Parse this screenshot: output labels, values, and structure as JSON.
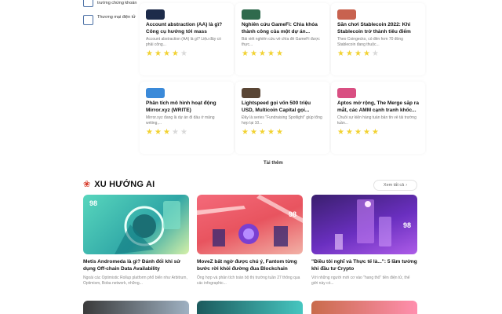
{
  "sidebar": {
    "items": [
      {
        "label": "trường chứng khoán",
        "icon": "chart-icon"
      },
      {
        "label": "Thương mại điện tử",
        "icon": "monitor-icon"
      }
    ]
  },
  "articles": [
    {
      "title": "Account abstraction (AA) là gì? Công cụ hướng tới mass adoption",
      "desc": "Account abstraction (AA) là gì? Liệu đây có phải công...",
      "rating": 4
    },
    {
      "title": "Nghiên cứu GameFi: Chìa khóa thành công của một dự án...",
      "desc": "Bài viết nghiên cứu về chìa đề GameFi được thực...",
      "rating": 5
    },
    {
      "title": "Săn chơi Stablecoin 2022: Khi Stablecoin trở thành tiêu điểm",
      "desc": "Theo Coingecko, có đến hơn 70 đồng Stablecoin đang thuộc...",
      "rating": 4
    },
    {
      "title": "Phân tích mô hình hoạt động Mirror.xyz (WRITE)",
      "desc": "Mirror.xyz đang là dự án đi đầu ở mảng writing,...",
      "rating": 3
    },
    {
      "title": "Lightspeed gọi vốn 500 triệu USD, Multicoin Capital gọi...",
      "desc": "Đây là series \"Fundraising Spotlight\" giúp tổng hợp lại 10...",
      "rating": 5
    },
    {
      "title": "Aptos mở rộng, The Merge sắp ra mắt, các AMM cạnh tranh khốc...",
      "desc": "Chuỗi sự kiện hàng tuần bản tin về tài trường tuần...",
      "rating": 5
    }
  ],
  "load_more": "Tải thêm",
  "trend": {
    "title": "XU HƯỚNG AI",
    "see_all": "Xem tất cả",
    "cards": [
      {
        "title": "Metis Andromeda là gì? Đánh đổi khi sử dụng Off-chain Data Availability",
        "desc": "Ngoài các Optimistic Rollup platform phổ biến như Arbitrum, Optimism, Boba network, những...",
        "badge": "98"
      },
      {
        "title": "MoveZ bất ngờ được chú ý, Fantom từng bước rời khỏi đường đua Blockchain",
        "desc": "Ông hợp và phân tích toàn bộ thị trường tuần 27 thông qua các infographic...",
        "badge": "98"
      },
      {
        "title": "\"Điều tôi nghĩ và Thực tế là...\": 5 lầm tưởng khi đầu tư Crypto",
        "desc": "Với những người mới cơ vào \"hang thỏ\" tiền điện tử, thế giới này có...",
        "badge": "98"
      }
    ]
  },
  "colors": {
    "star_on": "#f2d233",
    "star_off": "#d9d9d9",
    "accent_red": "#d83b2a"
  }
}
